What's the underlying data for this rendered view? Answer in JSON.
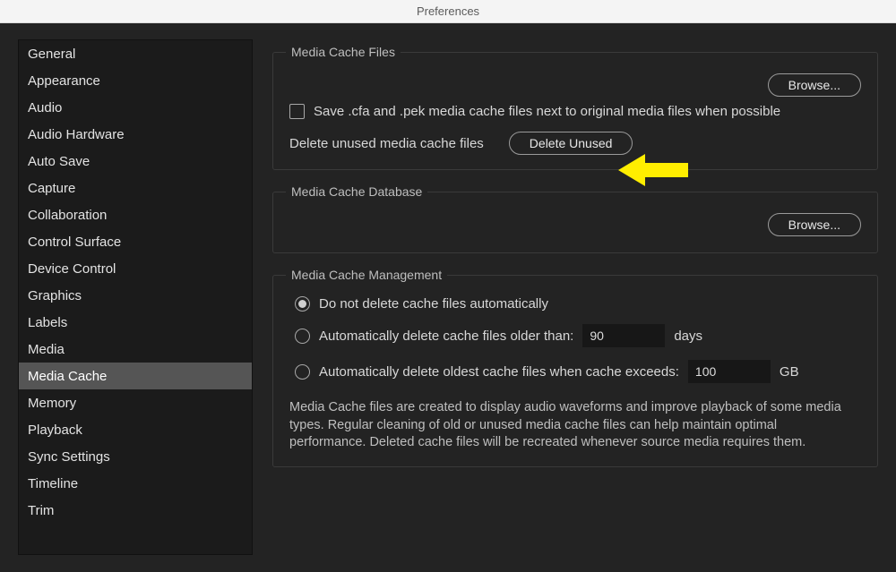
{
  "window": {
    "title": "Preferences"
  },
  "sidebar": {
    "items": [
      "General",
      "Appearance",
      "Audio",
      "Audio Hardware",
      "Auto Save",
      "Capture",
      "Collaboration",
      "Control Surface",
      "Device Control",
      "Graphics",
      "Labels",
      "Media",
      "Media Cache",
      "Memory",
      "Playback",
      "Sync Settings",
      "Timeline",
      "Trim"
    ],
    "selected_index": 12
  },
  "groups": {
    "cache_files": {
      "legend": "Media Cache Files",
      "browse": "Browse...",
      "save_next_to_original": {
        "label": "Save .cfa and .pek media cache files next to original media files when possible",
        "checked": false
      },
      "delete": {
        "label": "Delete unused media cache files",
        "button": "Delete Unused"
      }
    },
    "cache_db": {
      "legend": "Media Cache Database",
      "browse": "Browse..."
    },
    "management": {
      "legend": "Media Cache Management",
      "options": {
        "selected_index": 0,
        "opt0": "Do not delete cache files automatically",
        "opt1_label": "Automatically delete cache files older than:",
        "opt1_value": "90",
        "opt1_unit": "days",
        "opt2_label": "Automatically delete oldest cache files when cache exceeds:",
        "opt2_value": "100",
        "opt2_unit": "GB"
      },
      "help": "Media Cache files are created to display audio waveforms and improve playback of some media types.  Regular cleaning of old or unused media cache files can help maintain optimal performance. Deleted cache files will be recreated whenever source media requires them."
    }
  },
  "annotation": {
    "arrow_color": "#ffee00"
  }
}
